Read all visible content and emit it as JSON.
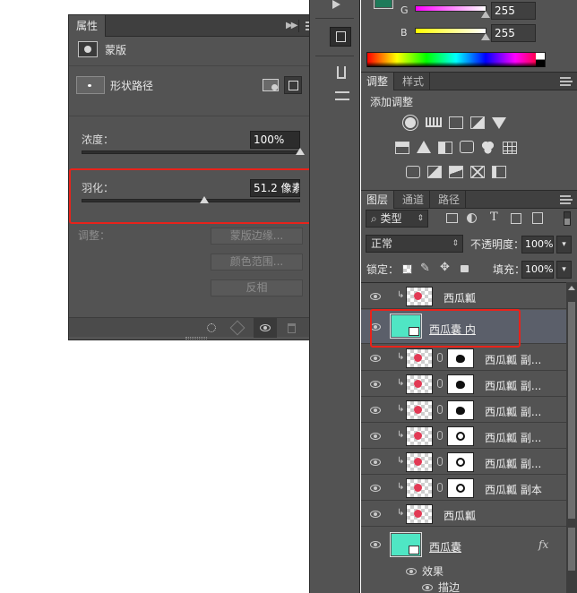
{
  "properties_panel": {
    "tab_title": "属性",
    "mask_label": "蒙版",
    "shape_path_label": "形状路径",
    "density_label": "浓度：",
    "density_value": "100%",
    "feather_label": "羽化：",
    "feather_value": "51.2 像素",
    "adjust_label": "调整：",
    "btn_mask_edge": "蒙版边缘...",
    "btn_color_range": "颜色范围...",
    "btn_invert": "反相",
    "density_fraction": 1.0,
    "feather_fraction": 0.56
  },
  "color_panel": {
    "g_label": "G",
    "g_value": "255",
    "b_label": "B",
    "b_value": "255",
    "fg_color": "#1e7a5a"
  },
  "adjust_panel": {
    "tab_adjust": "调整",
    "tab_style": "样式",
    "add_adjust_label": "添加调整"
  },
  "layers_panel": {
    "tab_layers": "图层",
    "tab_channels": "通道",
    "tab_paths": "路径",
    "filter_kind": "类型",
    "blend_mode": "正常",
    "opacity_label": "不透明度：",
    "opacity_value": "100%",
    "lock_label": "锁定：",
    "fill_label": "填充：",
    "fill_value": "100%",
    "layers": [
      {
        "name": "西瓜瓤"
      },
      {
        "name": "西瓜囊 内"
      },
      {
        "name": "西瓜瓤 副..."
      },
      {
        "name": "西瓜瓤 副..."
      },
      {
        "name": "西瓜瓤 副..."
      },
      {
        "name": "西瓜瓤 副..."
      },
      {
        "name": "西瓜瓤 副..."
      },
      {
        "name": "西瓜瓤 副本"
      },
      {
        "name": "西瓜瓤"
      },
      {
        "name": "西瓜囊"
      }
    ],
    "fx_label": "fx",
    "effects_label": "效果",
    "stroke_label": "描边",
    "shape_color": "#4fe6c4"
  }
}
